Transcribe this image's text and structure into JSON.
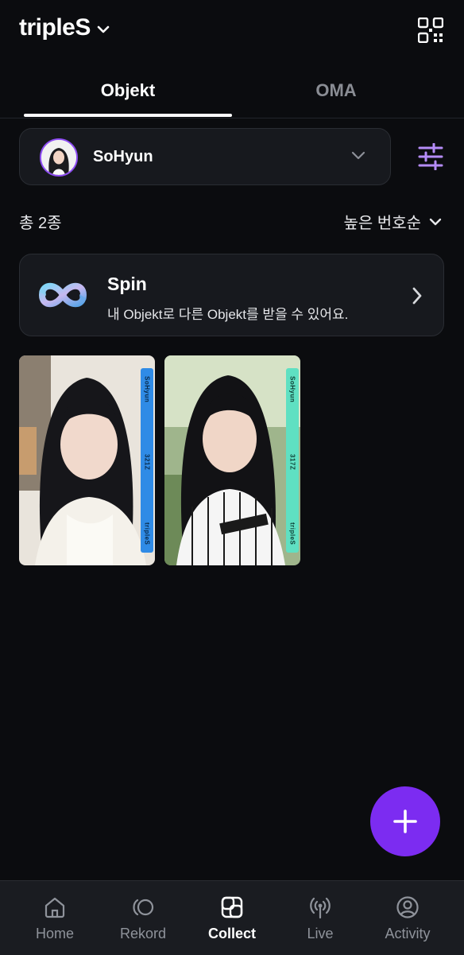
{
  "header": {
    "title": "tripleS"
  },
  "tabs": [
    {
      "label": "Objekt",
      "active": true
    },
    {
      "label": "OMA",
      "active": false
    }
  ],
  "member_select": {
    "name": "SoHyun"
  },
  "summary": {
    "count_label": "총 2종",
    "sort_label": "높은 번호순"
  },
  "spin": {
    "title": "Spin",
    "description": "내 Objekt로 다른 Objekt를 받을 수 있어요."
  },
  "objekts": [
    {
      "member": "SoHyun",
      "serial": "321Z",
      "group": "tripleS",
      "strip_color": "#2f8be6"
    },
    {
      "member": "SoHyun",
      "serial": "317Z",
      "group": "tripleS",
      "strip_color": "#5fe0c2"
    }
  ],
  "fab": {
    "icon": "plus-icon",
    "color": "#7c2cf1"
  },
  "bottom_nav": [
    {
      "label": "Home",
      "icon": "home-icon",
      "active": false
    },
    {
      "label": "Rekord",
      "icon": "rekord-icon",
      "active": false
    },
    {
      "label": "Collect",
      "icon": "collect-icon",
      "active": true
    },
    {
      "label": "Live",
      "icon": "live-icon",
      "active": false
    },
    {
      "label": "Activity",
      "icon": "activity-icon",
      "active": false
    }
  ],
  "colors": {
    "accent": "#7c2cf1",
    "background": "#0b0c0f",
    "card": "#17191e"
  }
}
